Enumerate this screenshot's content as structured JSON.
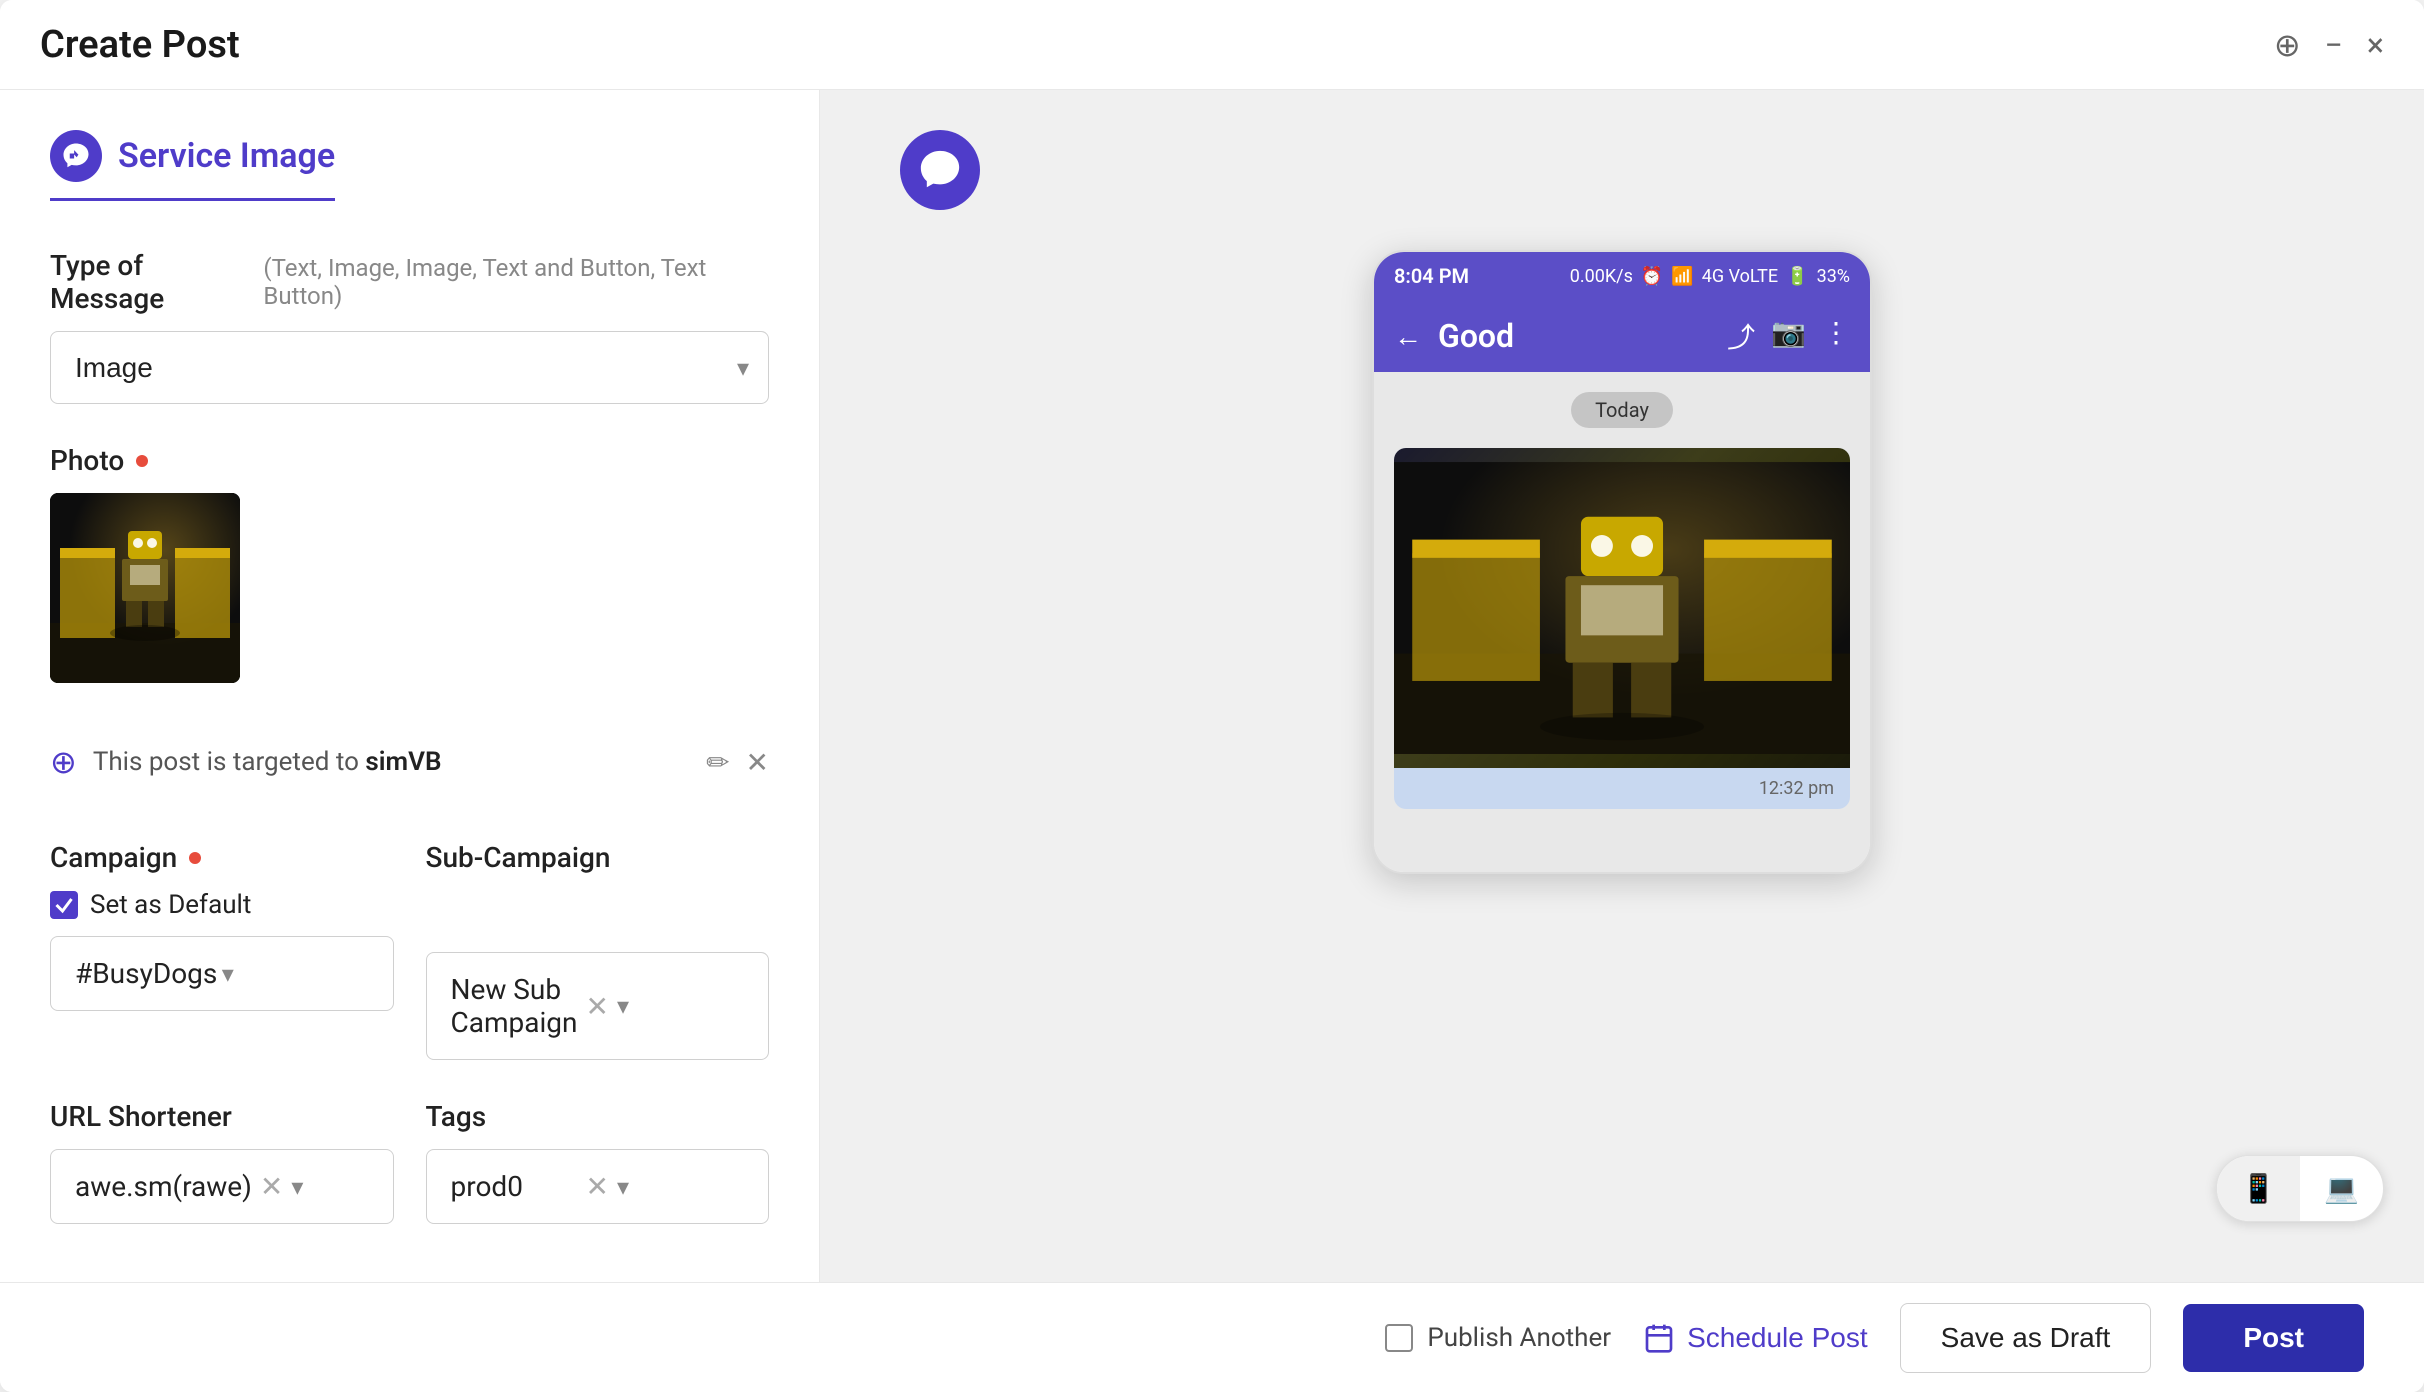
{
  "window": {
    "title": "Create Post",
    "close_label": "×",
    "minimize_label": "−",
    "pin_label": "⊕"
  },
  "tab": {
    "icon": "viber-icon",
    "label": "Service Image"
  },
  "form": {
    "message_type_label": "Type of Message",
    "message_type_hint": "(Text, Image, Image, Text and Button, Text Button)",
    "message_type_value": "Image",
    "photo_label": "Photo",
    "target_text_prefix": "This post is targeted to",
    "target_name": "simVB",
    "campaign_label": "Campaign",
    "set_default_label": "Set as Default",
    "campaign_value": "#BusyDogs",
    "sub_campaign_label": "Sub-Campaign",
    "sub_campaign_value": "New Sub Campaign",
    "url_shortener_label": "URL Shortener",
    "url_shortener_value": "awe.sm(rawe)",
    "tags_label": "Tags",
    "tags_value": "prod0"
  },
  "phone_preview": {
    "status_time": "8:04 PM",
    "status_speed": "0.00K/s",
    "status_network": "4G VoLTE",
    "status_battery": "33%",
    "chat_name": "Good",
    "message_date": "Today",
    "message_time": "12:32 pm"
  },
  "footer": {
    "publish_another_label": "Publish Another",
    "schedule_post_label": "Schedule Post",
    "save_draft_label": "Save as Draft",
    "post_label": "Post"
  }
}
